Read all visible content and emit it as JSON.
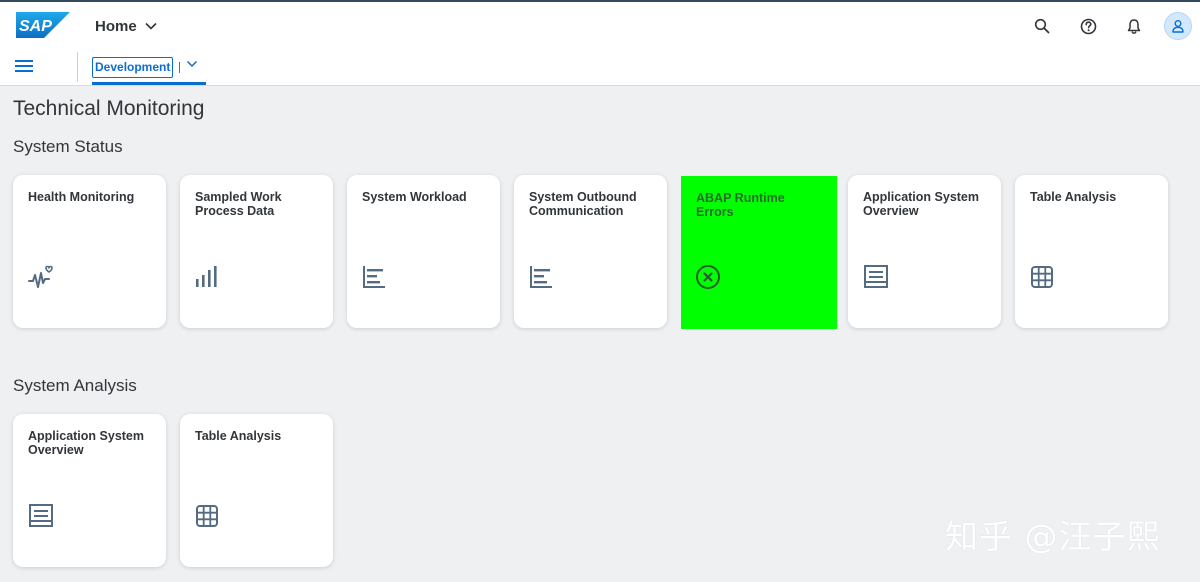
{
  "shell": {
    "logo_text": "SAP",
    "home_label": "Home",
    "space_tab_label": "Development"
  },
  "page": {
    "title": "Technical Monitoring"
  },
  "sections": [
    {
      "title": "System Status",
      "tiles": [
        {
          "title": "Health Monitoring",
          "icon": "health-monitoring-icon"
        },
        {
          "title": "Sampled Work Process Data",
          "icon": "bar-chart-icon"
        },
        {
          "title": "System Workload",
          "icon": "horizontal-bar-chart-icon"
        },
        {
          "title": "System Outbound Communication",
          "icon": "horizontal-bar-chart-icon"
        },
        {
          "title": "ABAP Runtime Errors",
          "icon": "error-circle-icon",
          "highlight_color": "#00ff00"
        },
        {
          "title": "Application System Overview",
          "icon": "overview-icon"
        },
        {
          "title": "Table Analysis",
          "icon": "table-grid-icon"
        }
      ]
    },
    {
      "title": "System Analysis",
      "tiles": [
        {
          "title": "Application System Overview",
          "icon": "overview-icon"
        },
        {
          "title": "Table Analysis",
          "icon": "table-grid-icon"
        }
      ]
    }
  ],
  "watermark": "知乎 @汪子熙",
  "colors": {
    "accent": "#0a6ed1",
    "tile_icon": "#556b82",
    "highlight": "#00ff00"
  }
}
